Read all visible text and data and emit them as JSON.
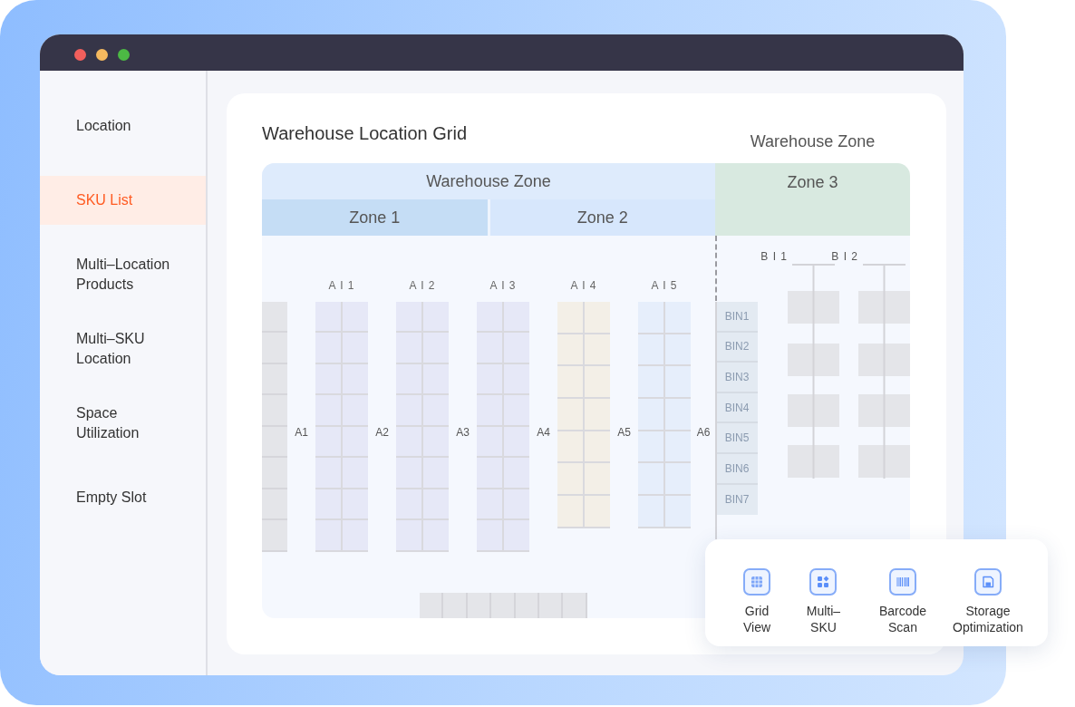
{
  "sidebar": {
    "items": [
      {
        "label": "Location",
        "selected": false
      },
      {
        "label": "SKU List",
        "selected": true
      },
      {
        "label": "Multi–Location Products",
        "selected": false
      },
      {
        "label": "Multi–SKU Location",
        "selected": false
      },
      {
        "label": "Space Utilization",
        "selected": false
      },
      {
        "label": "Empty Slot",
        "selected": false
      }
    ]
  },
  "card": {
    "title": "Warehouse Location Grid",
    "zone_caption": "Warehouse Zone"
  },
  "floor_plan": {
    "header": "Warehouse Zone",
    "zones": [
      {
        "label": "Zone 1",
        "kind": "sub",
        "color": "#c5ddf5"
      },
      {
        "label": "Zone 2",
        "kind": "sub",
        "color": "#d7e7fc"
      },
      {
        "label": "Zone 3",
        "kind": "side",
        "color": "#d8e9e0"
      }
    ],
    "racks": [
      {
        "label": "A I 1",
        "kind": "long",
        "color": "#e6e8f7"
      },
      {
        "label": "A I 2",
        "kind": "long",
        "color": "#e6e8f7"
      },
      {
        "label": "A I 3",
        "kind": "long",
        "color": "#e6e8f7"
      },
      {
        "label": "A I 4",
        "kind": "short",
        "color": "#f3efe7"
      },
      {
        "label": "A I 5",
        "kind": "short",
        "color": "#e6eefb"
      }
    ],
    "aisles": [
      "A1",
      "A2",
      "A3",
      "A4",
      "A5",
      "A6"
    ],
    "bins": [
      "BIN1",
      "BIN2",
      "BIN3",
      "BIN4",
      "BIN5",
      "BIN6",
      "BIN7"
    ],
    "side_racks": [
      "B I 1",
      "B I 2"
    ]
  },
  "toolbar": {
    "tools": [
      {
        "label": "Grid View",
        "kind": "grid"
      },
      {
        "label": "Multi–SKU",
        "kind": "tiles"
      },
      {
        "label": "Barcode Scan",
        "kind": "barcode"
      },
      {
        "label": "Storage Optimization",
        "kind": "storage"
      }
    ]
  }
}
